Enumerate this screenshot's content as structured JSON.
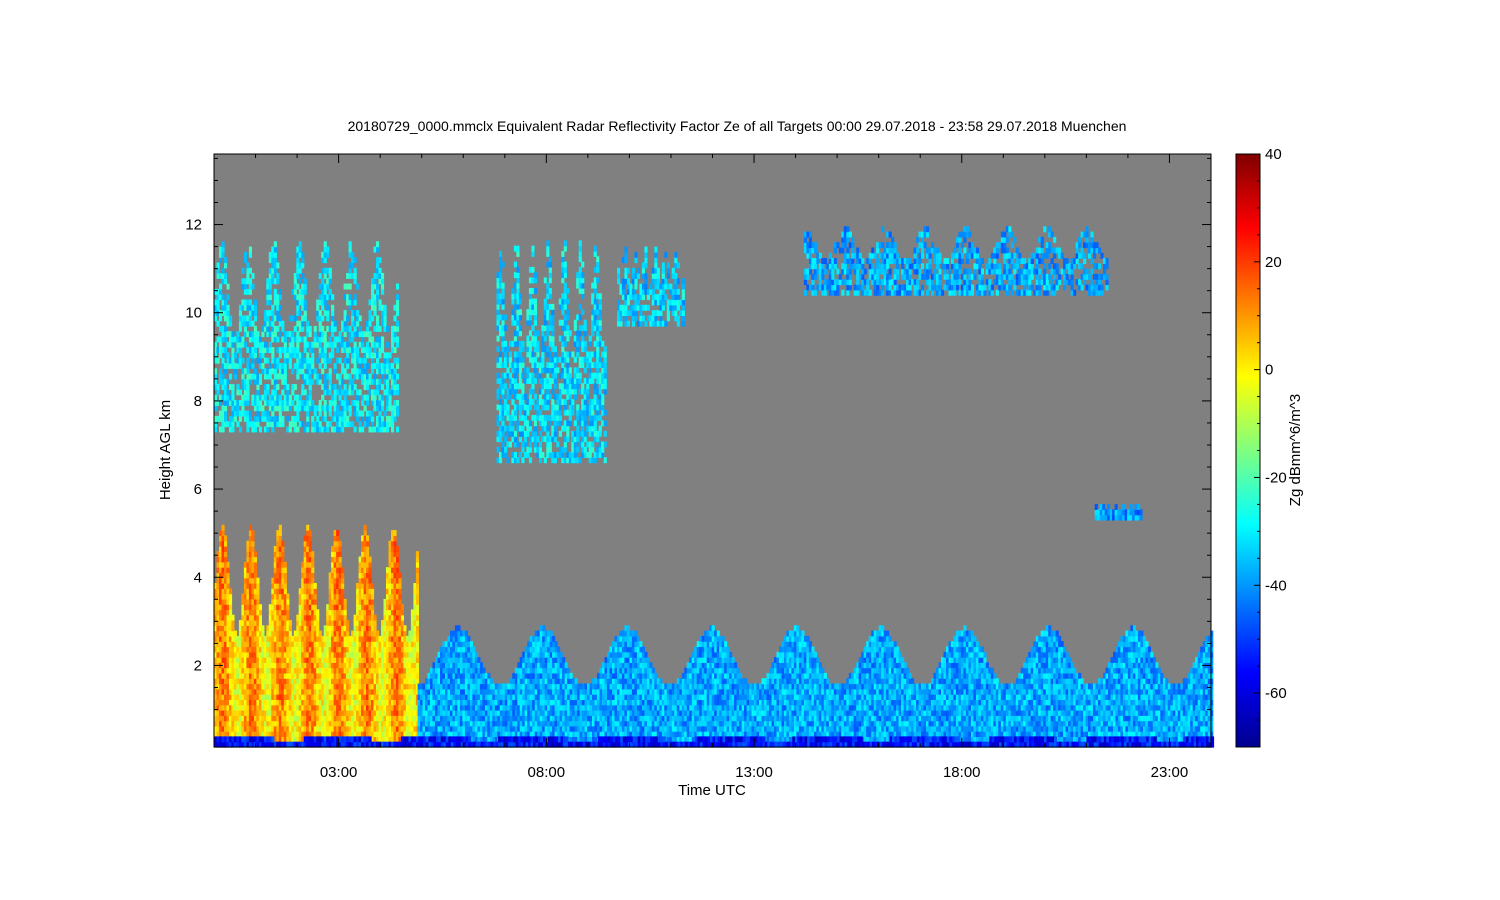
{
  "chart_data": {
    "type": "heatmap",
    "title": "20180729_0000.mmclx Equivalent Radar Reflectivity Factor Ze of all Targets   00:00 29.07.2018 - 23:58 29.07.2018 Muenchen",
    "xlabel": "Time UTC",
    "ylabel": "Height AGL km",
    "colorbar_label": "Zg dBmm^6/m^3",
    "x_unit": "hours UTC",
    "xlim": [
      0,
      24
    ],
    "ylim": [
      0.15,
      13.6
    ],
    "clim": [
      -70,
      40
    ],
    "x_ticks": [
      {
        "value": 3,
        "label": "03:00"
      },
      {
        "value": 8,
        "label": "08:00"
      },
      {
        "value": 13,
        "label": "13:00"
      },
      {
        "value": 18,
        "label": "18:00"
      },
      {
        "value": 23,
        "label": "23:00"
      }
    ],
    "y_ticks": [
      {
        "value": 2,
        "label": "2"
      },
      {
        "value": 4,
        "label": "4"
      },
      {
        "value": 6,
        "label": "6"
      },
      {
        "value": 8,
        "label": "8"
      },
      {
        "value": 10,
        "label": "10"
      },
      {
        "value": 12,
        "label": "12"
      }
    ],
    "colorbar_ticks": [
      {
        "value": 40,
        "label": "40"
      },
      {
        "value": 20,
        "label": "20"
      },
      {
        "value": 0,
        "label": "0"
      },
      {
        "value": -20,
        "label": "-20"
      },
      {
        "value": -40,
        "label": "-40"
      },
      {
        "value": -60,
        "label": "-60"
      }
    ],
    "colors": {
      "no_signal": "#808080",
      "colormap": "jet",
      "frame": "#000000"
    },
    "regions": [
      {
        "name": "precipitation",
        "x": [
          0,
          4.9
        ],
        "y": [
          0.15,
          5.1
        ],
        "z": 5
      },
      {
        "name": "boundary layer",
        "x": [
          4.9,
          24
        ],
        "y": [
          0.15,
          2.8
        ],
        "z": -38
      },
      {
        "name": "surface echo",
        "x": [
          0,
          24
        ],
        "y": [
          0.15,
          0.35
        ],
        "z": -55
      },
      {
        "name": "upper cirrus 1",
        "x": [
          0,
          4.4
        ],
        "y": [
          7.3,
          11.6
        ],
        "z": -30
      },
      {
        "name": "upper cirrus 2",
        "x": [
          6.8,
          9.4
        ],
        "y": [
          6.6,
          11.6
        ],
        "z": -32
      },
      {
        "name": "upper cirrus 3",
        "x": [
          9.7,
          11.3
        ],
        "y": [
          9.7,
          11.5
        ],
        "z": -34
      },
      {
        "name": "upper cirrus 4",
        "x": [
          14.2,
          21.5
        ],
        "y": [
          10.4,
          11.9
        ],
        "z": -38
      },
      {
        "name": "mid-level echo",
        "x": [
          21.2,
          22.3
        ],
        "y": [
          5.3,
          5.6
        ],
        "z": -40
      }
    ]
  }
}
